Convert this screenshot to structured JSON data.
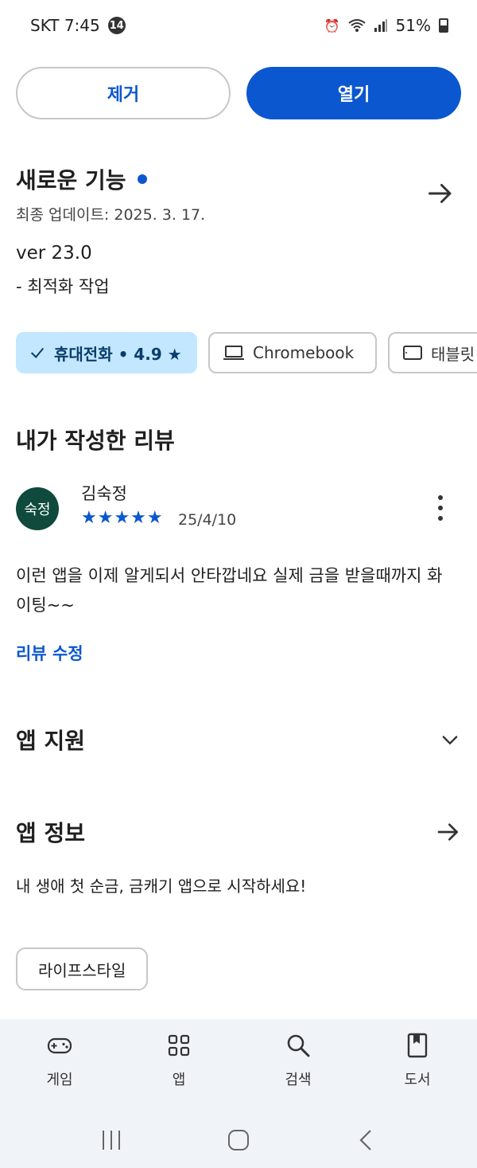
{
  "status_bar": {
    "carrier_time": "SKT 7:45",
    "notification_count": "14",
    "battery_percent": "51%"
  },
  "actions": {
    "remove_label": "제거",
    "open_label": "열기"
  },
  "whats_new": {
    "title": "새로운 기능",
    "last_updated": "최종 업데이트: 2025. 3. 17.",
    "version": "ver 23.0",
    "note": "- 최적화 작업"
  },
  "device_chips": {
    "phone": "휴대전화 • 4.9 ★",
    "chromebook": "Chromebook",
    "tablet": "태블릿"
  },
  "my_review": {
    "section_title": "내가 작성한 리뷰",
    "avatar_text": "숙정",
    "reviewer_name": "김숙정",
    "stars": "★★★★★",
    "rating": 5,
    "date": "25/4/10",
    "text": "이런 앱을 이제 알게되서 안타깝네요 실제 금을 받을때까지 화이팅~~",
    "edit_label": "리뷰 수정"
  },
  "app_support": {
    "title": "앱 지원"
  },
  "app_info": {
    "title": "앱 정보",
    "description": "내 생애 첫 순금, 금캐기 앱으로 시작하세요!",
    "category": "라이프스타일"
  },
  "bottom_nav": {
    "items": [
      {
        "label": "게임",
        "icon": "gamepad-icon"
      },
      {
        "label": "앱",
        "icon": "apps-grid-icon"
      },
      {
        "label": "검색",
        "icon": "search-icon"
      },
      {
        "label": "도서",
        "icon": "book-icon"
      }
    ]
  },
  "colors": {
    "accent": "#0b57d0",
    "chip_selected_bg": "#c2e7ff",
    "avatar_bg": "#0f4a3c",
    "nav_bg": "#f0f4f9"
  }
}
